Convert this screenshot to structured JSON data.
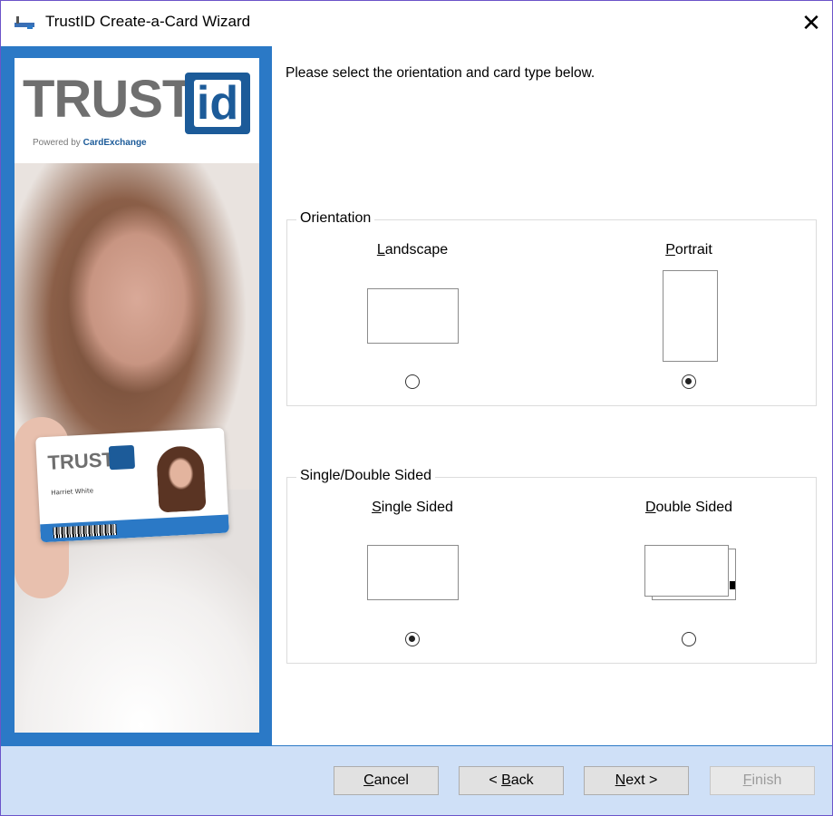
{
  "window": {
    "title": "TrustID Create-a-Card Wizard",
    "close_glyph": "✕"
  },
  "branding": {
    "logo_word": "TRUST",
    "logo_id": "id",
    "powered_prefix": "Powered by ",
    "powered_brand": "CardExchange",
    "card_logo_word": "TRUST",
    "card_name": "Harriet White"
  },
  "instruction": "Please select the orientation and card type below.",
  "orientation": {
    "legend": "Orientation",
    "landscape": {
      "mnemonic": "L",
      "rest": "andscape",
      "selected": false
    },
    "portrait": {
      "mnemonic": "P",
      "rest": "ortrait",
      "selected": true
    }
  },
  "sides": {
    "legend": "Single/Double Sided",
    "single": {
      "mnemonic": "S",
      "rest": "ingle Sided",
      "selected": true
    },
    "double": {
      "mnemonic": "D",
      "rest": "ouble Sided",
      "selected": false
    }
  },
  "buttons": {
    "cancel": {
      "mnemonic": "C",
      "rest": "ancel"
    },
    "back": {
      "pre": "< ",
      "mnemonic": "B",
      "rest": "ack"
    },
    "next": {
      "mnemonic": "N",
      "rest": "ext >"
    },
    "finish": {
      "mnemonic": "F",
      "rest": "inish",
      "enabled": false
    }
  },
  "colors": {
    "accent": "#2b79c6",
    "footer": "#cfe0f7",
    "logo_blue": "#1c5b99"
  }
}
